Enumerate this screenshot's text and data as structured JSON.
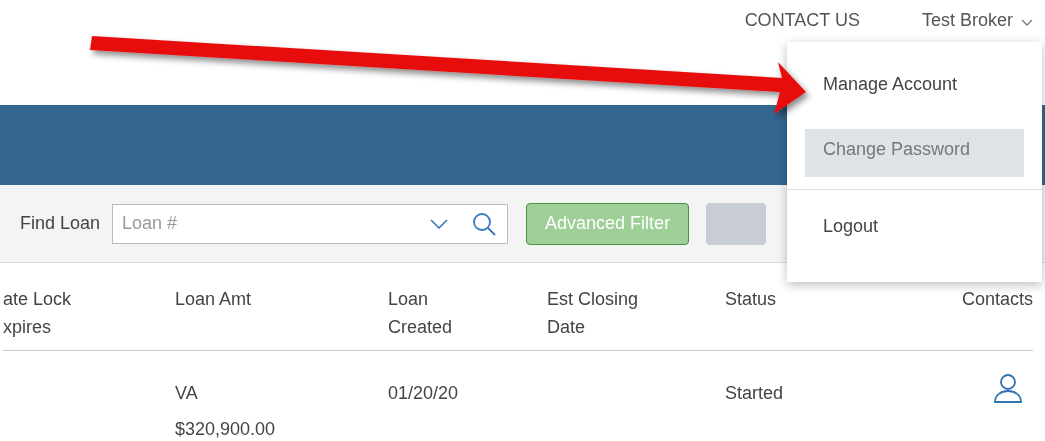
{
  "top_nav": {
    "contact_link": "CONTACT US",
    "user_menu": {
      "label": "Test Broker",
      "expanded": true,
      "items": [
        {
          "label": "Manage Account",
          "selected": false
        },
        {
          "label": "Change Password",
          "selected": true
        },
        {
          "label": "Logout",
          "selected": false,
          "divider_before": true
        }
      ]
    }
  },
  "filter_bar": {
    "label": "Find Loan",
    "search": {
      "placeholder": "Loan #"
    },
    "buttons": [
      {
        "label": "Advanced Filter",
        "kind": "green"
      },
      {
        "kind": "gray"
      }
    ]
  },
  "table": {
    "columns": [
      "ate Lock xpires",
      "Loan Amt",
      "Loan Created",
      "Est Closing Date",
      "Status",
      "Contacts"
    ],
    "rows": [
      {
        "cells": [
          "",
          [
            "VA",
            "$320,900.00"
          ],
          "01/20/20",
          "",
          "Started"
        ],
        "has_contact": true
      }
    ]
  }
}
